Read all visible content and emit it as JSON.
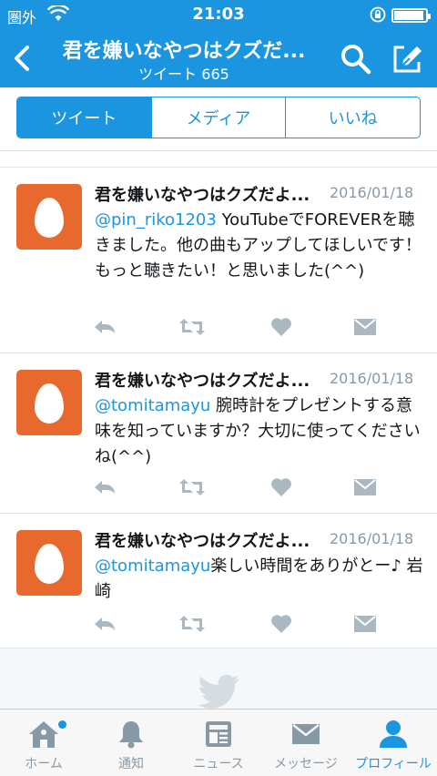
{
  "status_bar": {
    "carrier": "圏外",
    "time": "21:03",
    "battery_level": 0.95
  },
  "nav": {
    "title": "君を嫌いなやつはクズだ...",
    "subtitle": "ツイート 665"
  },
  "tabs": {
    "items": [
      {
        "label": "ツイート",
        "active": true
      },
      {
        "label": "メディア",
        "active": false
      },
      {
        "label": "いいね",
        "active": false
      }
    ]
  },
  "tweets": [
    {
      "name": "君を嫌いなやつはクズだよ...",
      "date": "2016/01/18",
      "mention": "@pin_riko1203",
      "body": " YouTubeでFOREVERを聴きました。他の曲もアップしてほしいです！もっと聴きたい！と思いました(^^)"
    },
    {
      "name": "君を嫌いなやつはクズだよ...",
      "date": "2016/01/18",
      "mention": "@tomitamayu",
      "body": " 腕時計をプレゼントする意味を知っていますか？大切に使ってくださいね(^^)"
    },
    {
      "name": "君を嫌いなやつはクズだよ...",
      "date": "2016/01/18",
      "mention": "@tomitamayu",
      "body": "楽しい時間をありがとー♪ 岩崎"
    }
  ],
  "bottom_tabs": [
    {
      "label": "ホーム",
      "icon": "home-icon"
    },
    {
      "label": "通知",
      "icon": "bell-icon"
    },
    {
      "label": "ニュース",
      "icon": "news-icon"
    },
    {
      "label": "メッセージ",
      "icon": "message-icon"
    },
    {
      "label": "プロフィール",
      "icon": "profile-icon"
    }
  ],
  "colors": {
    "brand": "#1b95e0",
    "avatar": "#e8692d",
    "muted": "#8899a6"
  }
}
